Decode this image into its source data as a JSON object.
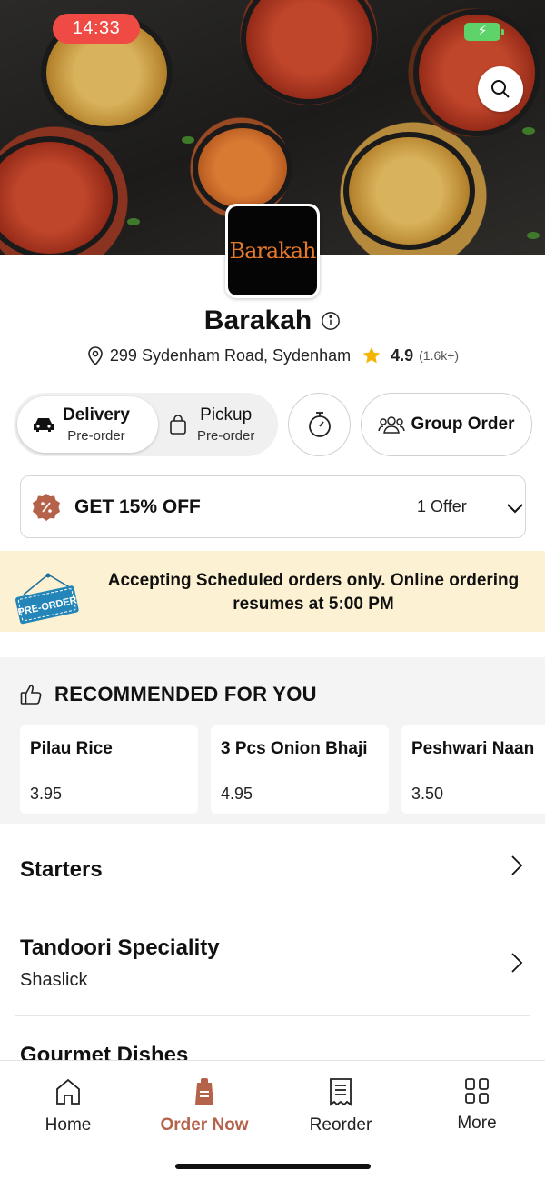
{
  "status_bar": {
    "time": "14:33"
  },
  "restaurant": {
    "logo_text": "Barakah",
    "name": "Barakah",
    "address": "299 Sydenham Road, Sydenham",
    "rating": "4.9",
    "rating_count": "(1.6k+)"
  },
  "mode": {
    "delivery": {
      "title": "Delivery",
      "sub": "Pre-order"
    },
    "pickup": {
      "title": "Pickup",
      "sub": "Pre-order"
    },
    "group_order_label": "Group Order"
  },
  "offer": {
    "title": "GET 15% OFF",
    "count": "1 Offer"
  },
  "banner": {
    "sign_text": "PRE-ORDER",
    "message": "Accepting Scheduled orders only. Online ordering resumes at 5:00 PM"
  },
  "recommended": {
    "title": "RECOMMENDED FOR YOU",
    "items": [
      {
        "name": "Pilau Rice",
        "price": "3.95"
      },
      {
        "name": "3 Pcs Onion Bhaji",
        "price": "4.95"
      },
      {
        "name": "Peshwari Naan",
        "price": "3.50"
      }
    ]
  },
  "categories": [
    {
      "name": "Starters",
      "sub": ""
    },
    {
      "name": "Tandoori Speciality",
      "sub": "Shaslick"
    },
    {
      "name": "Gourmet Dishes",
      "sub": ""
    }
  ],
  "nav": {
    "items": [
      {
        "label": "Home",
        "icon": "home-icon"
      },
      {
        "label": "Order Now",
        "icon": "order-bag-icon"
      },
      {
        "label": "Reorder",
        "icon": "receipt-icon"
      },
      {
        "label": "More",
        "icon": "grid-icon"
      }
    ],
    "active_index": 1
  },
  "colors": {
    "accent": "#b5624a",
    "banner": "#fcf1d2",
    "star": "#f5b400",
    "time_pill": "#f04a44"
  }
}
